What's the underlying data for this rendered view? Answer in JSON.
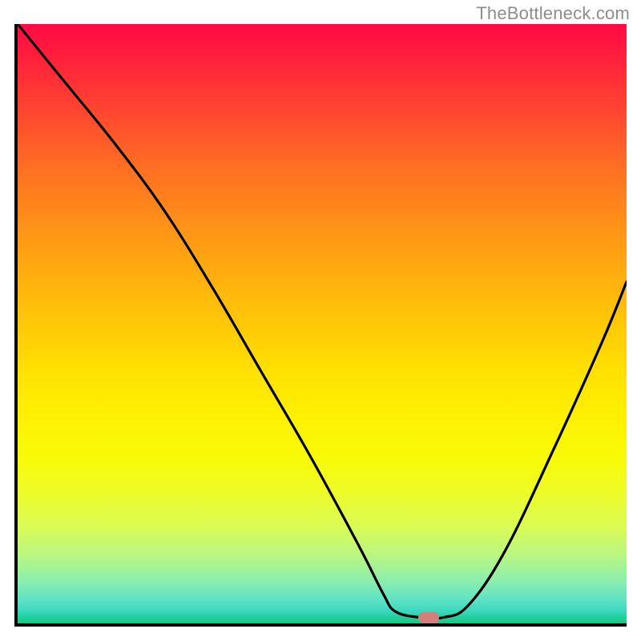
{
  "attribution": "TheBottleneck.com",
  "marker": {
    "color": "#d57f7b"
  },
  "chart_data": {
    "type": "line",
    "title": "",
    "xlabel": "",
    "ylabel": "",
    "xlim": [
      0,
      100
    ],
    "ylim": [
      0,
      100
    ],
    "grid": false,
    "legend": false,
    "background_gradient": {
      "direction": "vertical",
      "top": "#ff0b44",
      "bottom": "#12cc81"
    },
    "series": [
      {
        "name": "curve",
        "color": "#000000",
        "x": [
          0,
          8,
          16,
          24,
          32,
          40,
          48,
          56,
          60,
          62,
          66,
          70,
          74,
          80,
          88,
          96,
          100
        ],
        "y": [
          100,
          90,
          80,
          69,
          56,
          42,
          28,
          13,
          5,
          2,
          1,
          1,
          3,
          12,
          29,
          47,
          57
        ]
      }
    ],
    "marker_point": {
      "x": 67.5,
      "y": 1
    }
  }
}
